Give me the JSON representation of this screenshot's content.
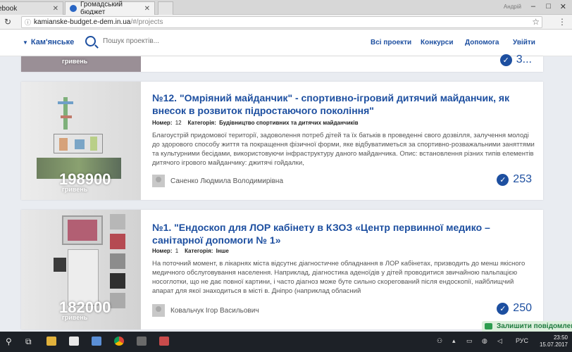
{
  "browser": {
    "tabs": [
      {
        "title": "ebook",
        "active": false
      },
      {
        "title": "Громадський бюджет",
        "active": true
      }
    ],
    "user_badge": "Андрій",
    "window_controls": [
      "–",
      "□",
      "✕"
    ],
    "url_host": "kamianske-budget.e-dem.in.ua",
    "url_path": "/#/projects"
  },
  "header": {
    "city": "Кам'янське",
    "search_placeholder": "Пошук проектів...",
    "nav": [
      "Всі проекти",
      "Конкурси",
      "Допомога",
      "Увійти"
    ]
  },
  "top_card": {
    "budget_unit": "гривень",
    "votes": "3..."
  },
  "projects": [
    {
      "title": "№12. \"Омріяний майданчик\" - спортивно-ігровий дитячий майданчик, як внесок в розвиток підростаючого покоління\"",
      "number_label": "Номер:",
      "number": "12",
      "category_label": "Категорія:",
      "category": "Будівництво спортивних та дитячих майданчиків",
      "description": "Благоустрій придомової території, задоволення потреб дітей та їх батьків в проведенні свого дозвілля, залучення молоді до здорового способу життя та покращення фізичної форми, яке відбуватиметься за спортивно-розважальними заняттями та культурними бесідами, використовуючи інфраструктуру даного майданчика. Опис: встановлення різних типів елементів дитячого ігрового майданчику: джитячі гойдалки,",
      "budget": "198900",
      "budget_unit": "гривень",
      "author": "Саненко Людмила Володимирівна",
      "votes": "253"
    },
    {
      "title": "№1. \"Ендоскоп для ЛОР кабінету в КЗОЗ «Центр первинної медико – санітарної допомоги № 1»",
      "number_label": "Номер:",
      "number": "1",
      "category_label": "Категорія:",
      "category": "Інше",
      "description": "На поточний момент, в лікарнях міста відсутнє діагностичне обладнання в ЛОР кабінетах, призводить до менш якісного медичного обслуговування населення. Наприклад, діагностика аденоїдів у дітей проводитися звичайною пальпацією носоглотки, що не дає повної картини, і часто діагноз може буте сильно скорегований після ендоскопії, найблищчий апарат для якої знаходиться в місті в. Дніпро (наприклад обласний",
      "budget": "182000",
      "budget_unit": "гривень",
      "author": "Ковальчук Ігор Васильович",
      "votes": "250"
    }
  ],
  "chat": {
    "label": "Залишити повідомлення"
  },
  "taskbar": {
    "lang": "РУС",
    "time": "23:50",
    "date": "15.07.2017"
  },
  "colors": {
    "brand_blue": "#1d4fa0",
    "chat_green": "#2d9d4f",
    "taskbar": "#1d2127"
  }
}
